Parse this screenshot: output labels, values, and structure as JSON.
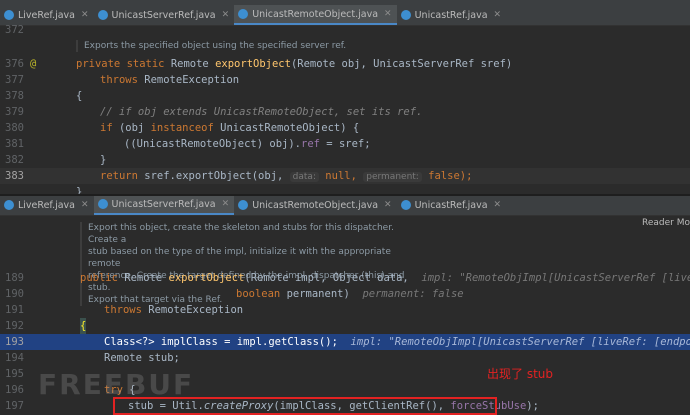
{
  "top_pane": {
    "tabs": [
      {
        "label": "LiveRef.java",
        "active": false
      },
      {
        "label": "UnicastServerRef.java",
        "active": false
      },
      {
        "label": "UnicastRemoteObject.java",
        "active": true
      },
      {
        "label": "UnicastRef.java",
        "active": false
      }
    ],
    "doc": "Exports the specified object using the specified server ref.",
    "lines": [
      {
        "n": "372"
      },
      {
        "n": "376"
      },
      {
        "n": "377"
      },
      {
        "n": "378"
      },
      {
        "n": "379"
      },
      {
        "n": "380"
      },
      {
        "n": "381"
      },
      {
        "n": "382"
      },
      {
        "n": "383"
      }
    ],
    "code": {
      "l376_kw": "private static ",
      "l376_type": "Remote ",
      "l376_fn": "exportObject",
      "l376_rest": "(Remote obj, UnicastServerRef sref)",
      "l377_kw": "throws ",
      "l377_rest": "RemoteException",
      "l378": "{",
      "l379": "// if obj extends UnicastRemoteObject, set its ref.",
      "l380_a": "if ",
      "l380_b": "(obj ",
      "l380_c": "instanceof ",
      "l380_d": "UnicastRemoteObject) {",
      "l381_a": "((UnicastRemoteObject) obj).",
      "l381_b": "ref",
      "l381_c": " = sref;",
      "l382": "}",
      "l383_kw": "return ",
      "l383_a": "sref.exportObject(obj, ",
      "l383_h1": "data:",
      "l383_b": " null, ",
      "l383_h2": "permanent:",
      "l383_c": " false);",
      "l384": "}"
    },
    "annotation_icon": "@"
  },
  "bottom_pane": {
    "tabs": [
      {
        "label": "LiveRef.java",
        "active": false
      },
      {
        "label": "UnicastServerRef.java",
        "active": true
      },
      {
        "label": "UnicastRemoteObject.java",
        "active": false
      },
      {
        "label": "UnicastRef.java",
        "active": false
      }
    ],
    "reader_mode": "Reader Mo",
    "doc_lines": [
      "Export this object, create the skeleton and stubs for this dispatcher. Create a",
      "stub based on the type of the impl, initialize it with the appropriate remote",
      "reference. Create the target defined by the impl, dispatcher (this) and stub.",
      "Export that target via the Ref."
    ],
    "lines": [
      {
        "n": "189"
      },
      {
        "n": "190"
      },
      {
        "n": "191"
      },
      {
        "n": "192"
      },
      {
        "n": "193"
      },
      {
        "n": "194"
      },
      {
        "n": "195"
      },
      {
        "n": "196"
      },
      {
        "n": "197"
      }
    ],
    "code": {
      "l189_kw": "public ",
      "l189_type": "Remote ",
      "l189_fn": "exportObject",
      "l189_rest": "(Remote impl, Object data,  ",
      "l189_inl": "impl: \"RemoteObjImpl[UnicastServerRef [liveRef: [end",
      "l190_kw": "boolean ",
      "l190_rest": "permanent)  ",
      "l190_inl": "permanent: false",
      "l191_kw": "throws ",
      "l191_rest": "RemoteException",
      "l192": "{",
      "l193_a": "Class<?> implClass = impl.getClass();  ",
      "l193_inl": "impl: \"RemoteObjImpl[UnicastServerRef [liveRef: [endpoint:[192.",
      "l194": "Remote stub;",
      "l196_kw": "try ",
      "l196_rest": "{",
      "l197_a": "stub = Util.",
      "l197_b": "createProxy",
      "l197_c": "(implClass, getClientRef(), ",
      "l197_d": "forceStubUse",
      "l197_e": ");"
    }
  },
  "annotation_label": "出现了 stub",
  "watermark": "FREEBUF",
  "colors": {
    "highlight_line": "#214283",
    "annotation_box": "#e32222",
    "active_tab_underline": "#4a88c7"
  }
}
